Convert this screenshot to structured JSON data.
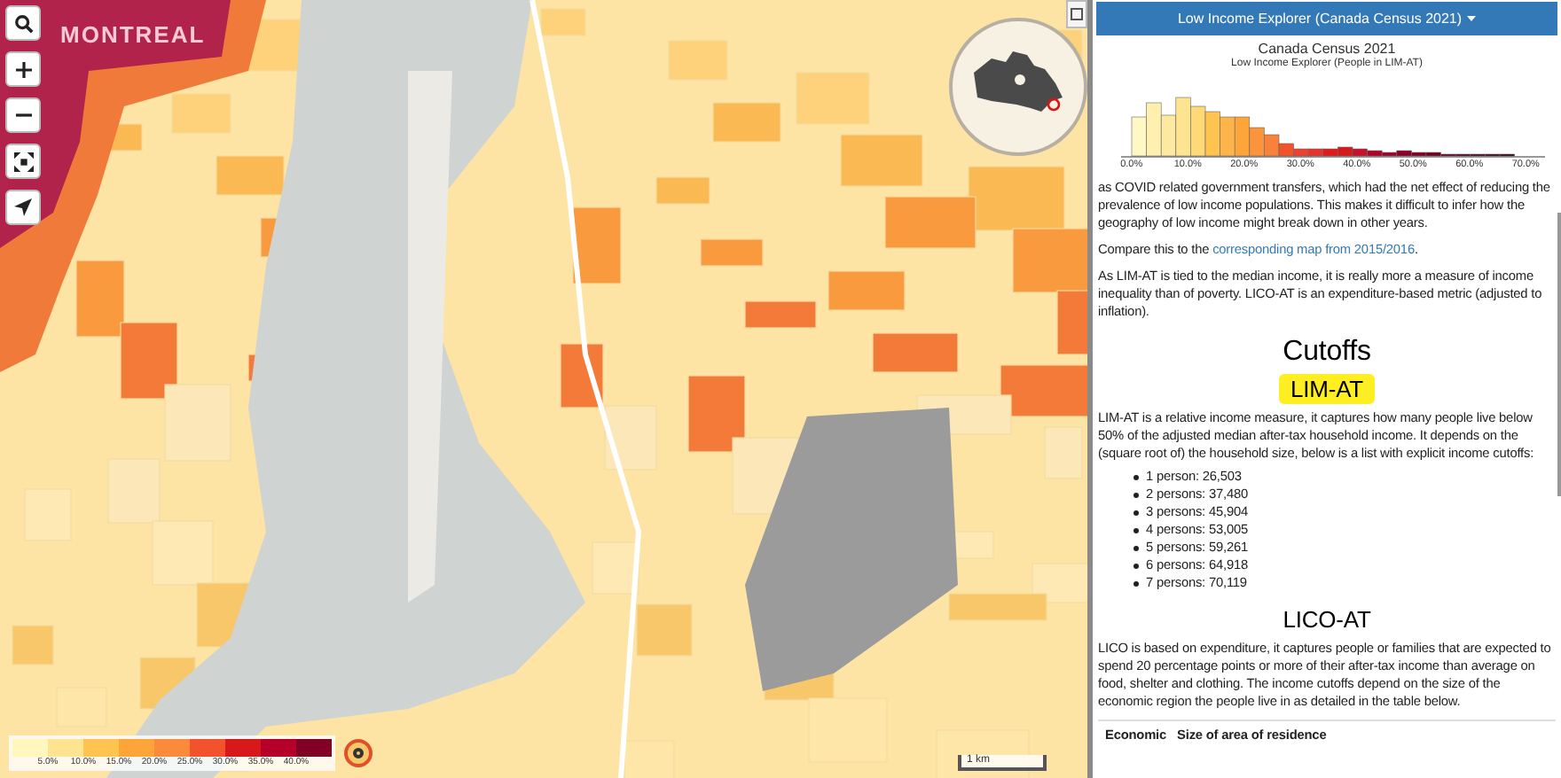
{
  "map": {
    "place_label": "MONTREAL",
    "scale_label": "1 km"
  },
  "map_controls": [
    {
      "kind": "search"
    },
    {
      "kind": "zoom_in"
    },
    {
      "kind": "zoom_out"
    },
    {
      "kind": "fullscreen"
    },
    {
      "kind": "locate"
    }
  ],
  "legend": {
    "swatches": [
      {
        "color": "#fff7bc"
      },
      {
        "color": "#fee391"
      },
      {
        "color": "#fec44f"
      },
      {
        "color": "#fea53a"
      },
      {
        "color": "#fb8a3a"
      },
      {
        "color": "#f2522c"
      },
      {
        "color": "#d7191c"
      },
      {
        "color": "#b5002a"
      },
      {
        "color": "#800026"
      }
    ],
    "labels": [
      "5.0%",
      "10.0%",
      "15.0%",
      "20.0%",
      "25.0%",
      "30.0%",
      "35.0%",
      "40.0%"
    ]
  },
  "panel": {
    "menu_title": "Low Income Explorer (Canada Census 2021)",
    "chart_title": "Canada Census 2021",
    "chart_subtitle": "Low Income Explorer (People in LIM-AT)",
    "histogram_ticks": [
      "0.0%",
      "10.0%",
      "20.0%",
      "30.0%",
      "40.0%",
      "50.0%",
      "60.0%",
      "70.0%"
    ],
    "blocks": [
      {
        "kind": "paragraph",
        "text": "as COVID related government transfers, which had the net effect of reducing the prevalence of low income populations. This makes it difficult to infer how the geography of low income might break down in other years."
      },
      {
        "kind": "link_paragraph",
        "before": "Compare this to the ",
        "link": "corresponding map from 2015/2016",
        "after": "."
      },
      {
        "kind": "paragraph",
        "text": "As LIM-AT is tied to the median income, it is really more a measure of income inequality than of poverty. LICO-AT is an expenditure-based metric (adjusted to inflation)."
      },
      {
        "kind": "title",
        "text": "Cutoffs"
      },
      {
        "kind": "heading",
        "text": "LIM-AT",
        "highlighted": true
      },
      {
        "kind": "paragraph",
        "text": "LIM-AT is a relative income measure, it captures how many people live below 50% of the adjusted median after-tax household income. It depends on the (square root of) the household size, below is a list with explicit income cutoffs:"
      },
      {
        "kind": "list",
        "items": [
          "1 person: 26,503",
          "2 persons: 37,480",
          "3 persons: 45,904",
          "4 persons: 53,005",
          "5 persons: 59,261",
          "6 persons: 64,918",
          "7 persons: 70,119"
        ]
      },
      {
        "kind": "heading",
        "text": "LICO-AT",
        "highlighted": false
      },
      {
        "kind": "paragraph",
        "text": "LICO is based on expenditure, it captures people or families that are expected to spend 20 percentage points or more of their after-tax income than average on food, shelter and clothing. The income cutoffs depend on the size of the economic region the people live in as detailed in the table below."
      },
      {
        "kind": "table_header",
        "columns": [
          "Economic",
          "Size of area of residence"
        ]
      }
    ]
  }
}
